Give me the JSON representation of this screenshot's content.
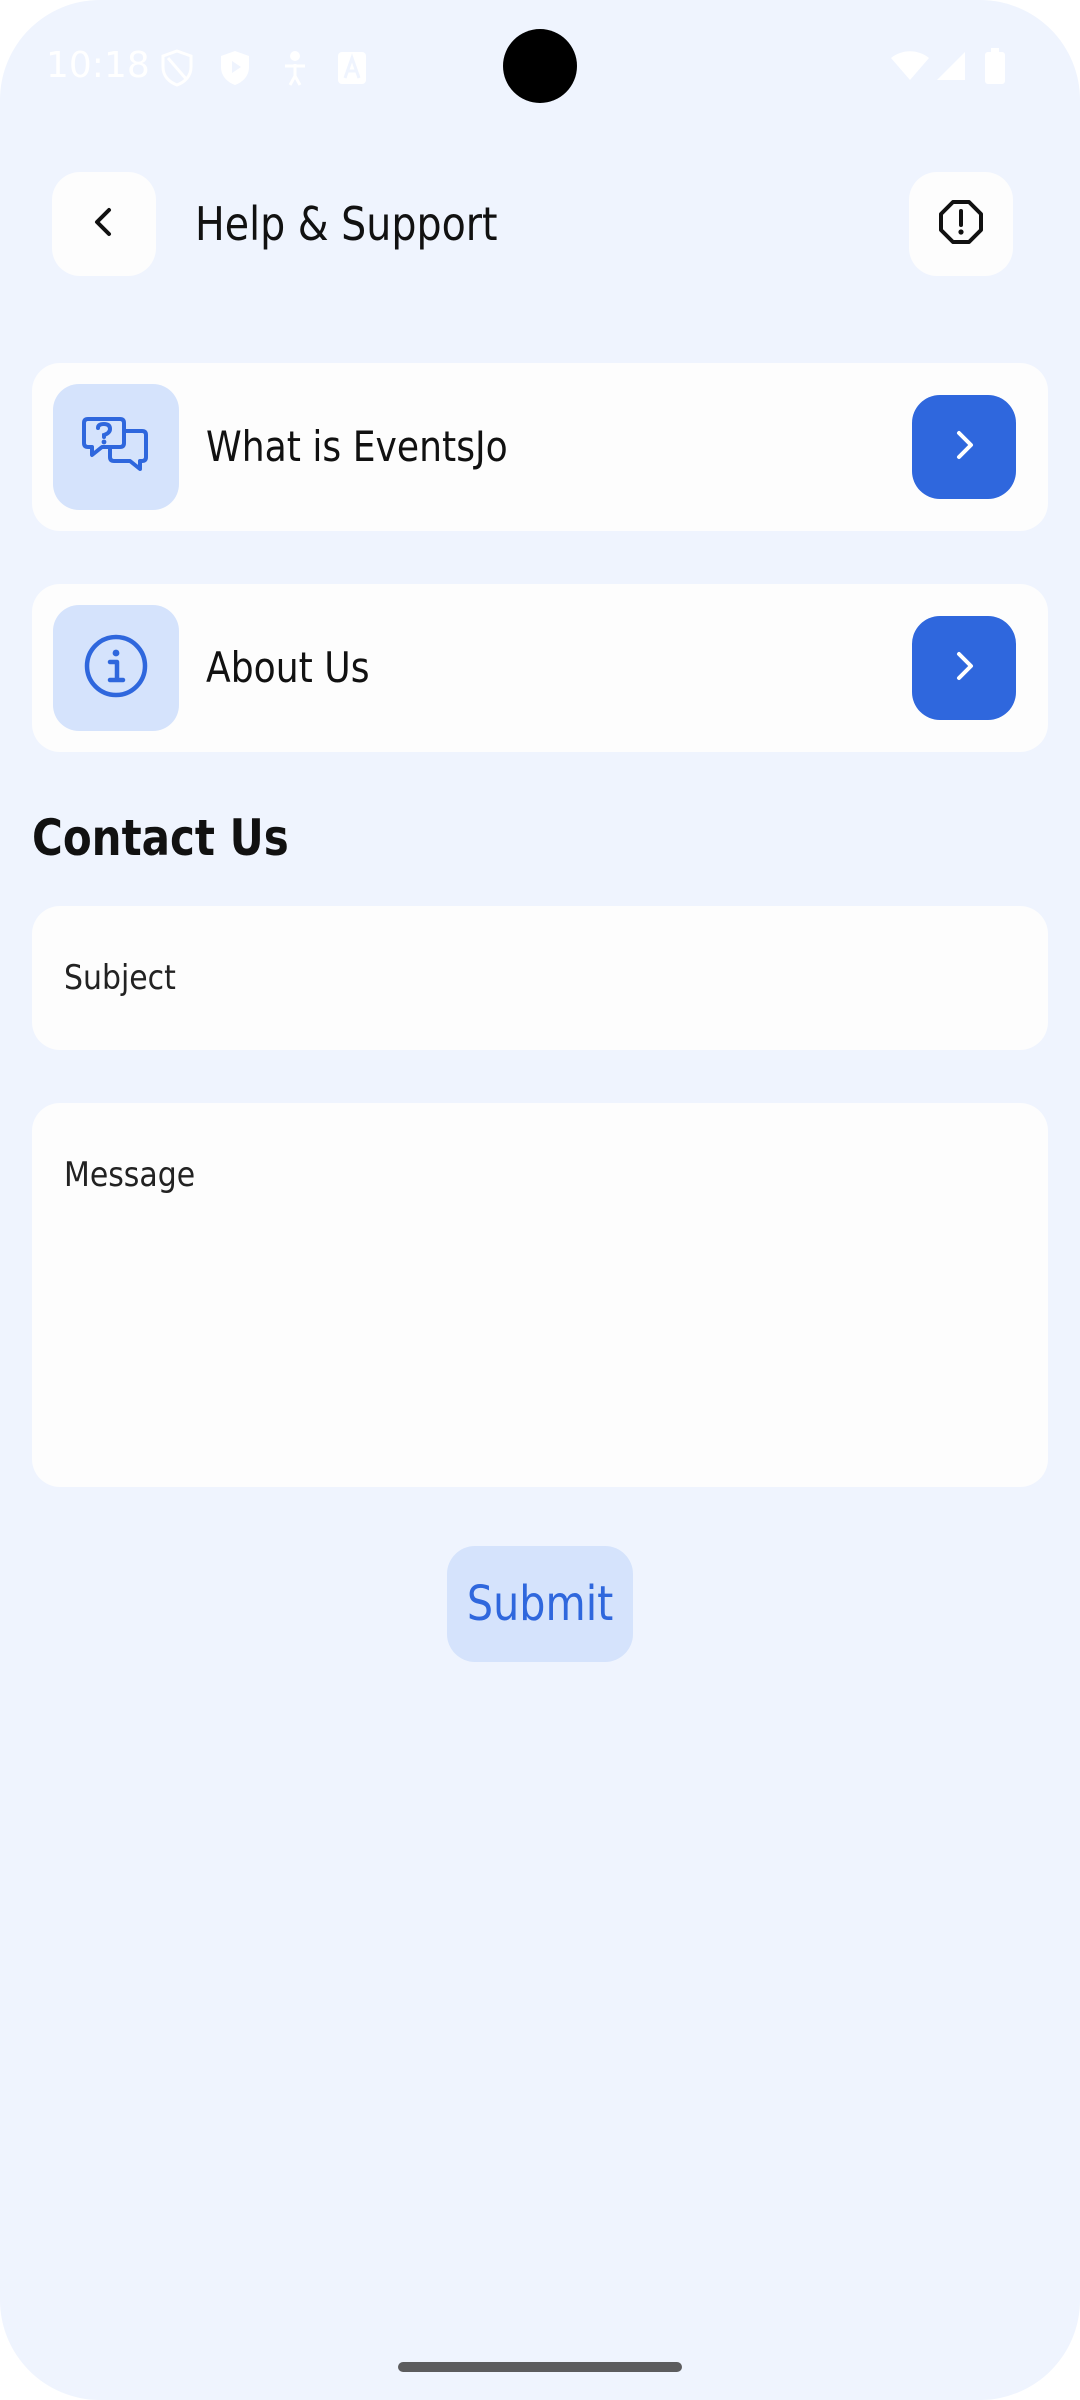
{
  "status_bar": {
    "time": "10:18",
    "icons": [
      "vpn-shield-icon",
      "play-protect-icon",
      "accessibility-icon",
      "font-a-icon",
      "wifi-icon",
      "signal-icon",
      "battery-icon"
    ]
  },
  "header": {
    "title": "Help & Support",
    "back_icon": "chevron-left-icon",
    "report_icon": "alert-octagon-icon"
  },
  "menu": [
    {
      "label": "What is EventsJo",
      "icon": "question-chat-icon",
      "arrow_icon": "chevron-right-icon"
    },
    {
      "label": "About Us",
      "icon": "info-circle-icon",
      "arrow_icon": "chevron-right-icon"
    }
  ],
  "contact": {
    "title": "Contact Us",
    "subject_placeholder": "Subject",
    "subject_value": "",
    "message_placeholder": "Message",
    "message_value": "",
    "submit_label": "Submit"
  },
  "colors": {
    "background": "#eff4fe",
    "card": "#fdfdfd",
    "accent": "#2f67dd",
    "accent_light": "#d5e3fc",
    "text": "#111111"
  }
}
